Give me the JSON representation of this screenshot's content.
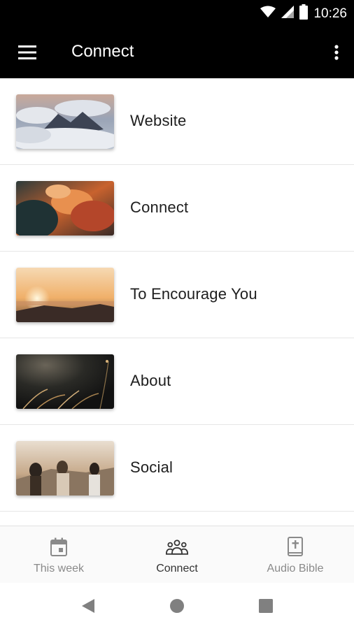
{
  "status_bar": {
    "time": "10:26",
    "icons": [
      "wifi-icon",
      "signal-icon",
      "battery-icon"
    ]
  },
  "app_bar": {
    "title": "Connect",
    "menu_icon": "hamburger-menu-icon",
    "overflow_icon": "more-vertical-icon",
    "background": "#000000"
  },
  "list": {
    "items": [
      {
        "label": "Website",
        "thumbnail": "clouds-mountain-photo"
      },
      {
        "label": "Connect",
        "thumbnail": "sunset-clouds-photo"
      },
      {
        "label": "To Encourage You",
        "thumbnail": "sunrise-horizon-photo"
      },
      {
        "label": "About",
        "thumbnail": "night-grass-photo"
      },
      {
        "label": "Social",
        "thumbnail": "friends-outdoors-photo"
      }
    ]
  },
  "bottom_nav": {
    "tabs": [
      {
        "label": "This week",
        "icon": "calendar-icon",
        "active": false
      },
      {
        "label": "Connect",
        "icon": "group-people-icon",
        "active": true
      },
      {
        "label": "Audio Bible",
        "icon": "bible-book-icon",
        "active": false
      }
    ],
    "active_color": "#333333",
    "inactive_color": "#8a8a8a"
  },
  "system_nav": {
    "buttons": [
      "back-triangle-icon",
      "home-circle-icon",
      "recents-square-icon"
    ]
  }
}
